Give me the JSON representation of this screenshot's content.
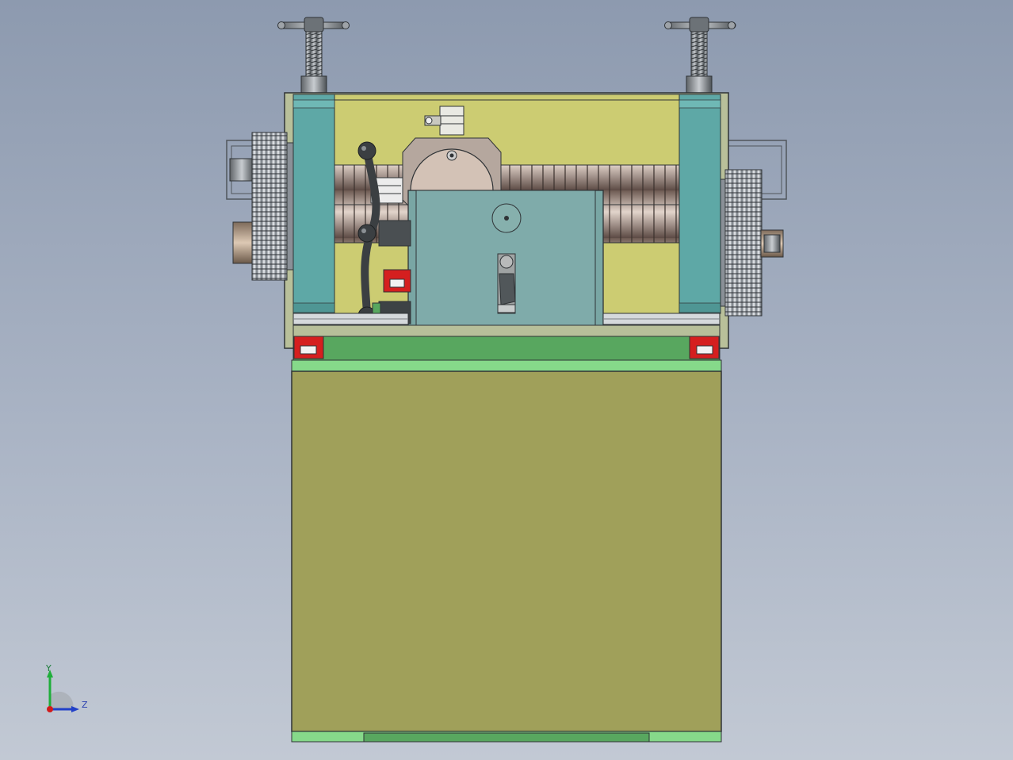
{
  "viewport": {
    "view": "front",
    "background_top": "#8d9aaf",
    "background_bottom": "#c2c9d4"
  },
  "model": {
    "colors": {
      "base_cabinet": "#a0a05a",
      "frame_panel": "#cccc72",
      "side_column": "#5ea8a6",
      "carriage": "#79a6a4",
      "rail_plate": "#58a75f",
      "rail_strip": "#86d98a",
      "bearing_block": "#d51f1f",
      "roller": "#bba59b",
      "handwheel": "#3b3f42",
      "gear": "#c9ced4",
      "hub": "#b89c78"
    }
  },
  "triad": {
    "y_label": "Y",
    "z_label": "Z",
    "y_color": "#1fae3a",
    "z_color": "#2140c8",
    "x_color": "#d11b1b"
  }
}
